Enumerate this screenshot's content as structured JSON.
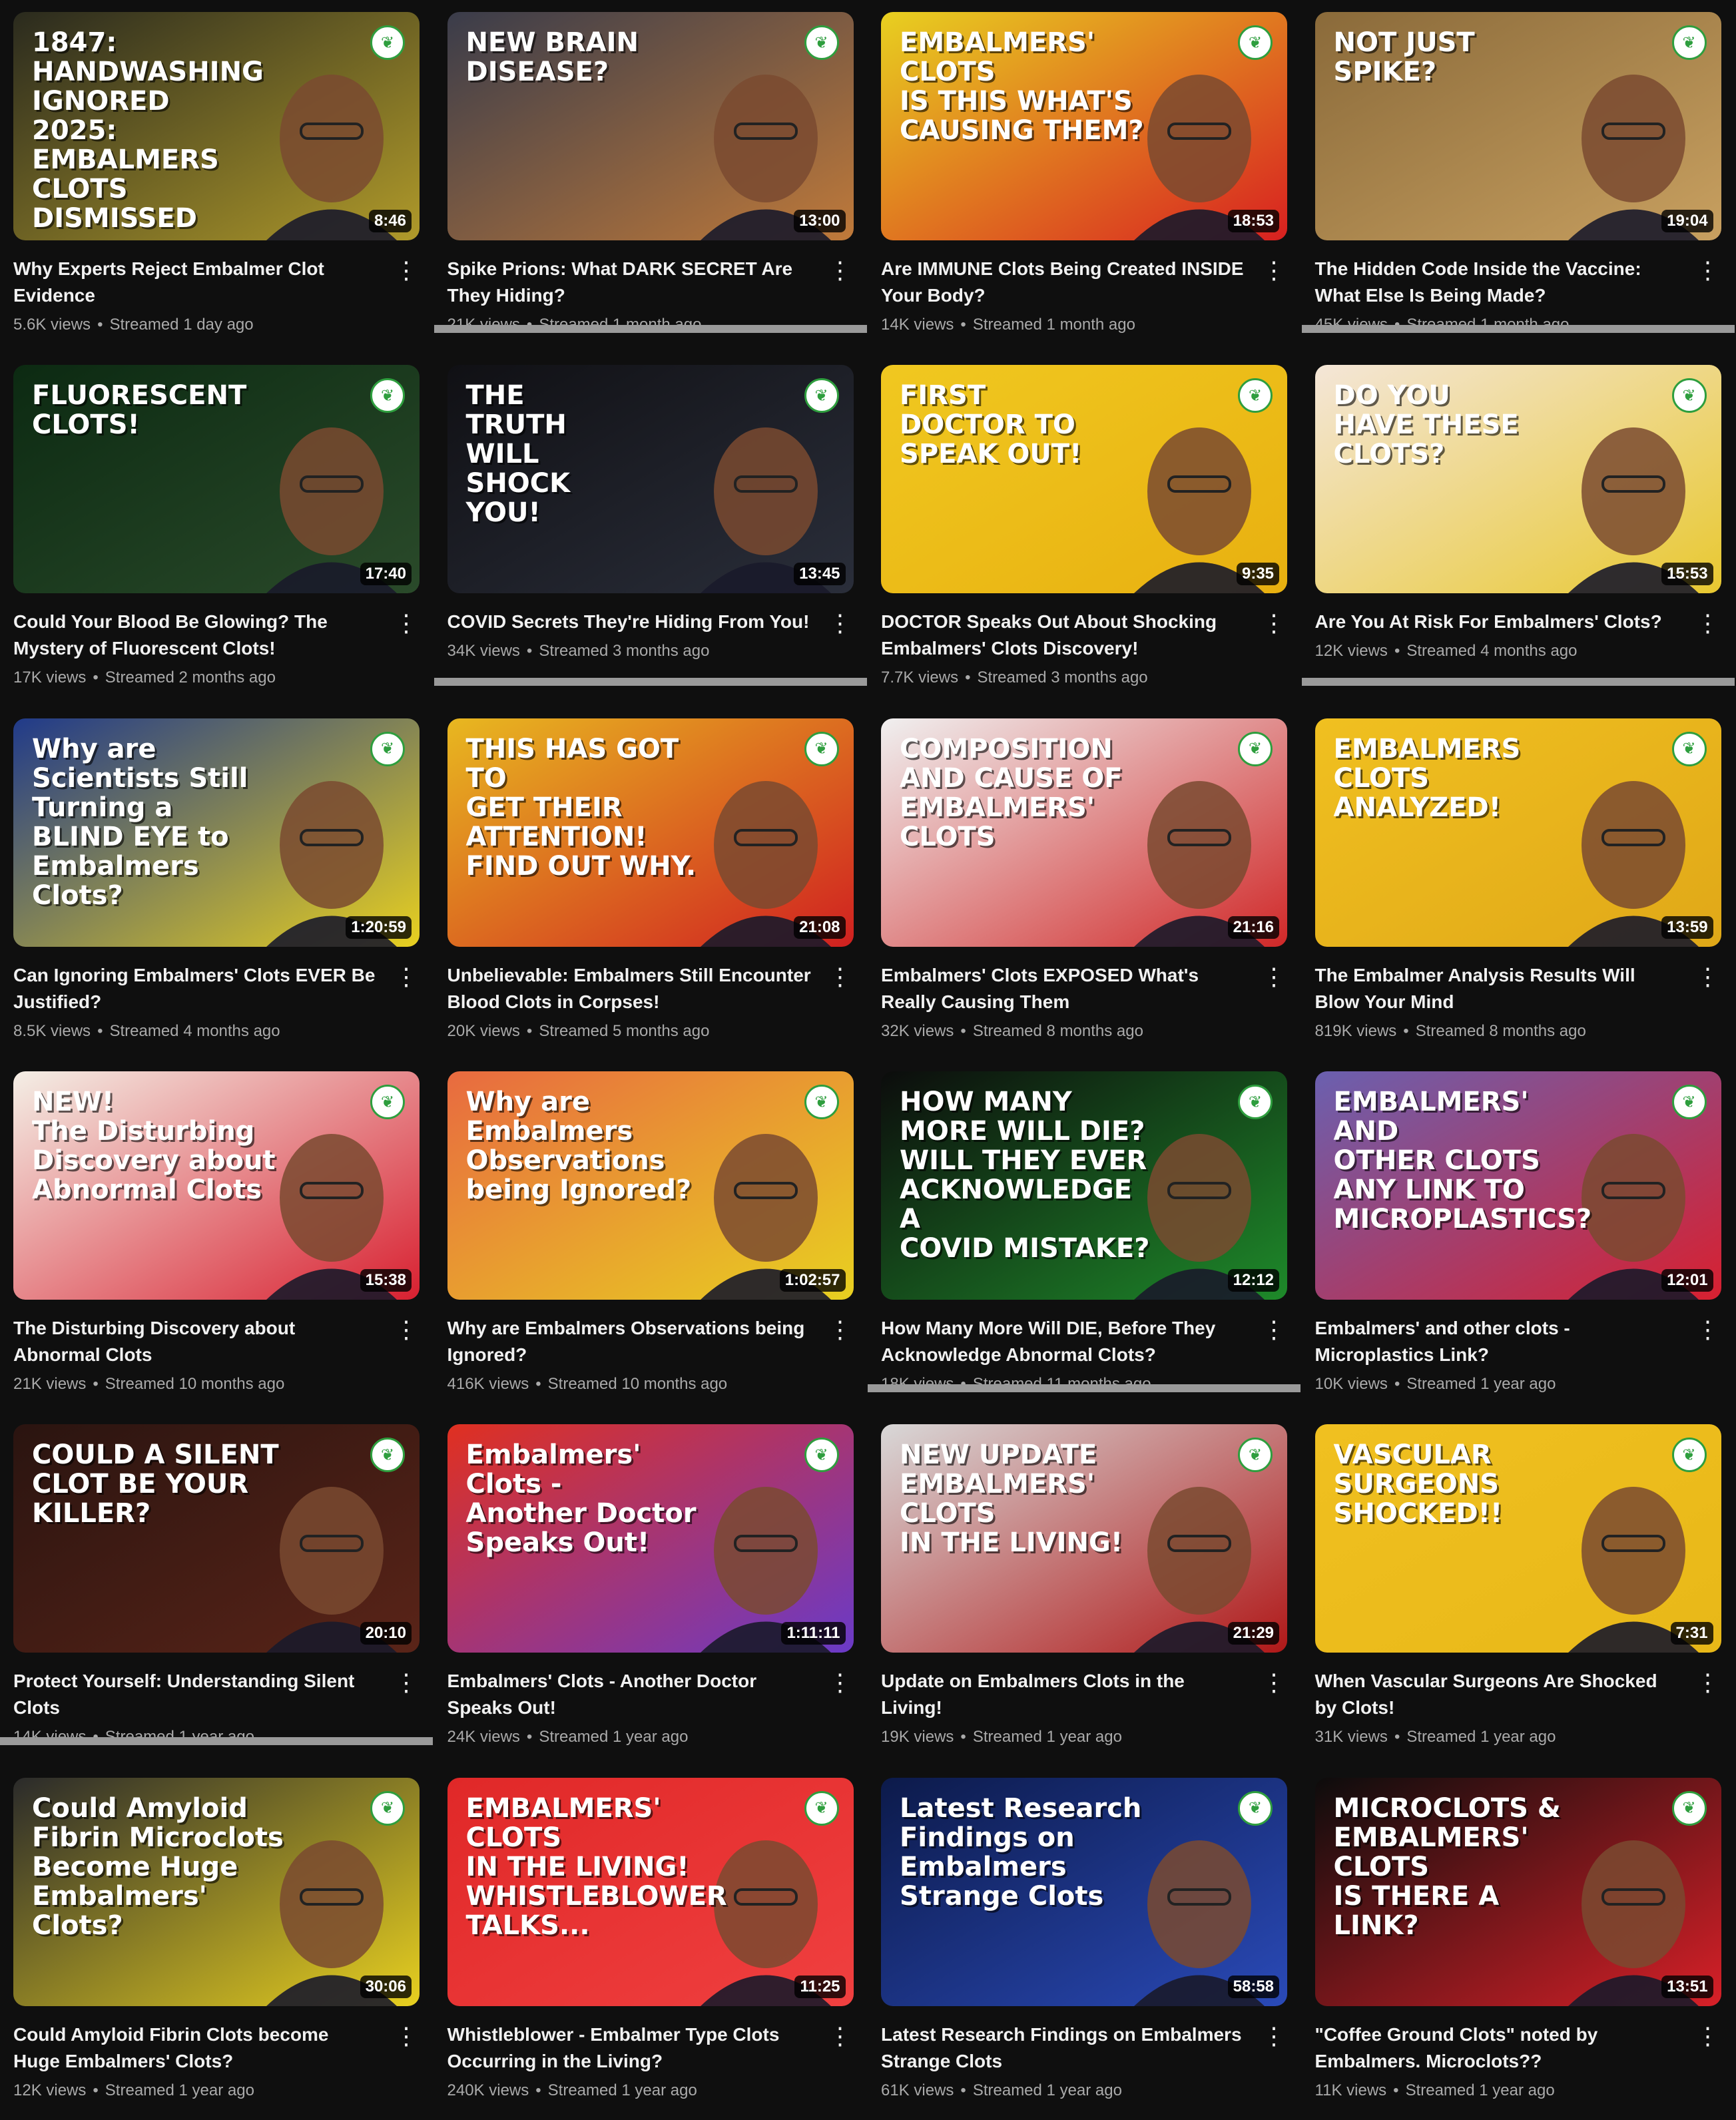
{
  "videos": [
    {
      "title": "Why Experts Reject Embalmer Clot Evidence",
      "views": "5.6K views",
      "age": "Streamed 1 day ago",
      "duration": "8:46",
      "thumb_text": "1847:\nHANDWASHING\nIGNORED\n2025:\nEMBALMERS\nCLOTS\nDISMISSED",
      "bg": [
        "#2a2a1e",
        "#b09a2a"
      ]
    },
    {
      "title": "Spike Prions: What DARK SECRET Are They Hiding?",
      "views": "21K views",
      "age": "Streamed 1 month ago",
      "duration": "13:00",
      "thumb_text": "NEW BRAIN\nDISEASE?",
      "bg": [
        "#3a3c4a",
        "#c07a3a"
      ]
    },
    {
      "title": "Are IMMUNE Clots Being Created INSIDE Your Body?",
      "views": "14K views",
      "age": "Streamed 1 month ago",
      "duration": "18:53",
      "thumb_text": "EMBALMERS' CLOTS\nIS THIS WHAT'S\nCAUSING THEM?",
      "bg": [
        "#e8d020",
        "#d82020"
      ]
    },
    {
      "title": "The Hidden Code Inside the Vaccine: What Else Is Being Made?",
      "views": "45K views",
      "age": "Streamed 1 month ago",
      "duration": "19:04",
      "thumb_text": "NOT JUST\nSPIKE?",
      "bg": [
        "#8a6a3a",
        "#c8a060"
      ]
    },
    {
      "title": "Could Your Blood Be Glowing? The Mystery of Fluorescent Clots!",
      "views": "17K views",
      "age": "Streamed 2 months ago",
      "duration": "17:40",
      "thumb_text": "FLUORESCENT\nCLOTS!",
      "bg": [
        "#0c2a12",
        "#2a4a2a"
      ]
    },
    {
      "title": "COVID Secrets They're Hiding From You!",
      "views": "34K views",
      "age": "Streamed 3 months ago",
      "duration": "13:45",
      "thumb_text": "THE\nTRUTH\nWILL\nSHOCK\nYOU!",
      "bg": [
        "#101014",
        "#2a2e3a"
      ]
    },
    {
      "title": "DOCTOR Speaks Out About Shocking Embalmers' Clots Discovery!",
      "views": "7.7K views",
      "age": "Streamed 3 months ago",
      "duration": "9:35",
      "thumb_text": "FIRST\nDOCTOR TO\nSPEAK OUT!",
      "bg": [
        "#f0c820",
        "#e8b010"
      ]
    },
    {
      "title": "Are You At Risk For Embalmers' Clots?",
      "views": "12K views",
      "age": "Streamed 4 months ago",
      "duration": "15:53",
      "thumb_text": "DO YOU\nHAVE THESE\nCLOTS?",
      "bg": [
        "#f4e6d8",
        "#e8c830"
      ]
    },
    {
      "title": "Can Ignoring Embalmers' Clots EVER Be Justified?",
      "views": "8.5K views",
      "age": "Streamed 4 months ago",
      "duration": "1:20:59",
      "thumb_text": "Why are Scientists Still Turning a\nBLIND EYE to Embalmers Clots?",
      "bg": [
        "#203a8a",
        "#e8d020"
      ]
    },
    {
      "title": "Unbelievable: Embalmers Still Encounter Blood Clots in Corpses!",
      "views": "20K views",
      "age": "Streamed 5 months ago",
      "duration": "21:08",
      "thumb_text": "THIS HAS GOT TO\nGET THEIR\nATTENTION!\nFIND OUT WHY.",
      "bg": [
        "#e8b820",
        "#d02020"
      ]
    },
    {
      "title": "Embalmers' Clots EXPOSED What's Really Causing Them",
      "views": "32K views",
      "age": "Streamed 8 months ago",
      "duration": "21:16",
      "thumb_text": "COMPOSITION\nAND CAUSE OF\nEMBALMERS'\nCLOTS",
      "bg": [
        "#f0f0f0",
        "#d02828"
      ]
    },
    {
      "title": "The Embalmer Analysis Results Will Blow Your Mind",
      "views": "819K views",
      "age": "Streamed 8 months ago",
      "duration": "13:59",
      "thumb_text": "EMBALMERS\nCLOTS\nANALYZED!",
      "bg": [
        "#f0c020",
        "#e0a818"
      ]
    },
    {
      "title": "The Disturbing Discovery about Abnormal Clots",
      "views": "21K views",
      "age": "Streamed 10 months ago",
      "duration": "15:38",
      "thumb_text": "NEW!\nThe Disturbing\nDiscovery about\nAbnormal Clots",
      "bg": [
        "#f4efe6",
        "#d82030"
      ]
    },
    {
      "title": "Why are Embalmers Observations being Ignored?",
      "views": "416K views",
      "age": "Streamed 10 months ago",
      "duration": "1:02:57",
      "thumb_text": "Why are Embalmers\nObservations being Ignored?",
      "bg": [
        "#e86a40",
        "#e8d020"
      ]
    },
    {
      "title": "How Many More Will DIE, Before They Acknowledge Abnormal Clots?",
      "views": "18K views",
      "age": "Streamed 11 months ago",
      "duration": "12:12",
      "thumb_text": "HOW MANY MORE WILL DIE?\nWILL THEY EVER\nACKNOWLEDGE A\nCOVID MISTAKE?",
      "bg": [
        "#0c0c0c",
        "#1e8a2a"
      ]
    },
    {
      "title": "Embalmers' and other clots - Microplastics Link?",
      "views": "10K views",
      "age": "Streamed 1 year ago",
      "duration": "12:01",
      "thumb_text": "EMBALMERS' AND\nOTHER CLOTS\nANY LINK TO MICROPLASTICS?",
      "bg": [
        "#6a60b0",
        "#d82030"
      ]
    },
    {
      "title": "Protect Yourself: Understanding Silent Clots",
      "views": "14K views",
      "age": "Streamed 1 year ago",
      "duration": "20:10",
      "thumb_text": "COULD A SILENT\nCLOT BE YOUR\nKILLER?",
      "bg": [
        "#2a1410",
        "#5a2418"
      ]
    },
    {
      "title": "Embalmers' Clots - Another Doctor Speaks Out!",
      "views": "24K views",
      "age": "Streamed 1 year ago",
      "duration": "1:11:11",
      "thumb_text": "Embalmers' Clots -\nAnother Doctor Speaks Out!",
      "bg": [
        "#e03020",
        "#6a3ac8"
      ]
    },
    {
      "title": "Update on Embalmers Clots in the Living!",
      "views": "19K views",
      "age": "Streamed 1 year ago",
      "duration": "21:29",
      "thumb_text": "NEW UPDATE\nEMBALMERS' CLOTS\nIN THE LIVING!",
      "bg": [
        "#d8d8d8",
        "#b01818"
      ]
    },
    {
      "title": "When Vascular Surgeons Are Shocked by Clots!",
      "views": "31K views",
      "age": "Streamed 1 year ago",
      "duration": "7:31",
      "thumb_text": "VASCULAR\nSURGEONS\nSHOCKED!!",
      "bg": [
        "#f0c020",
        "#e8b818"
      ]
    },
    {
      "title": "Could Amyloid Fibrin Clots become Huge Embalmers' Clots?",
      "views": "12K views",
      "age": "Streamed 1 year ago",
      "duration": "30:06",
      "thumb_text": "Could Amyloid Fibrin Microclots\nBecome Huge Embalmers' Clots?",
      "bg": [
        "#2a2a2a",
        "#e8d020"
      ]
    },
    {
      "title": "Whistleblower - Embalmer Type Clots Occurring in the Living?",
      "views": "240K views",
      "age": "Streamed 1 year ago",
      "duration": "11:25",
      "thumb_text": "EMBALMERS' CLOTS\nIN THE LIVING!\nWHISTLEBLOWER TALKS...",
      "bg": [
        "#e02828",
        "#f04040"
      ]
    },
    {
      "title": "Latest Research Findings on Embalmers Strange Clots",
      "views": "61K views",
      "age": "Streamed 1 year ago",
      "duration": "58:58",
      "thumb_text": "Latest Research\nFindings on\nEmbalmers\nStrange Clots",
      "bg": [
        "#0c1a4a",
        "#2a4ab8"
      ]
    },
    {
      "title": "\"Coffee Ground Clots\" noted by Embalmers. Microclots??",
      "views": "11K views",
      "age": "Streamed 1 year ago",
      "duration": "13:51",
      "thumb_text": "MICROCLOTS &\nEMBALMERS'\nCLOTS\nIS THERE A LINK?",
      "bg": [
        "#0c0c0c",
        "#d82028"
      ]
    }
  ],
  "menu_glyph": "⋮",
  "logo_glyph": "❦",
  "icons": {
    "menu": "more-vert-icon",
    "logo": "channel-logo-icon"
  }
}
